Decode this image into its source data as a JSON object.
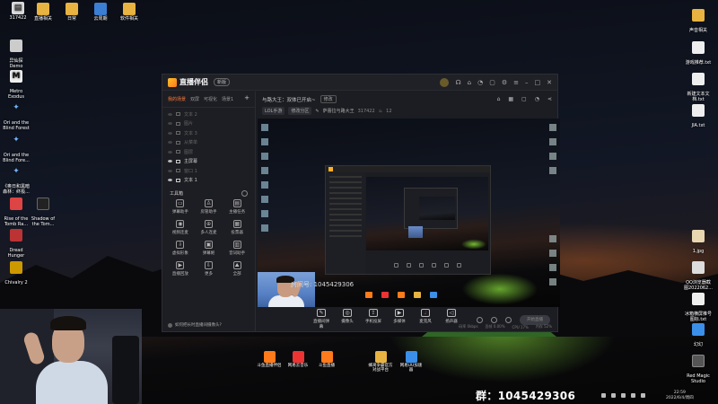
{
  "desktop": {
    "top_icons": [
      {
        "label": "直播相关",
        "color": "#e8b341"
      },
      {
        "label": "日常",
        "color": "#e8b341"
      },
      {
        "label": "云周期",
        "color": "#3b7fd4"
      },
      {
        "label": "软件相关",
        "color": "#e8b341"
      }
    ],
    "corner_label": "317422",
    "left_icons": [
      {
        "label": "异仙探\nDemo",
        "color": "#ccc"
      },
      {
        "label": "Metro\nExodus",
        "color": "#eee"
      },
      {
        "label": "Ori and the\nBlind Forest",
        "color": "#6fb3ff"
      },
      {
        "label": "Ori and the\nBlind Fore...",
        "color": "#6fb3ff"
      },
      {
        "label": "《奥日和黑暗\n森林：终极...",
        "color": "#6fb3ff"
      }
    ],
    "left_icons_row": [
      {
        "label": "Rise of the\nTomb Ra...",
        "color": "#d44"
      },
      {
        "label": "Shadow of\nthe Tom...",
        "color": "#222"
      }
    ],
    "left_icons_lower": [
      {
        "label": "Dread\nHunger",
        "color": "#b33"
      },
      {
        "label": "Chivalry 2",
        "color": "#c90"
      }
    ],
    "right_icons": [
      {
        "label": "声音相关",
        "color": "#e8b341"
      },
      {
        "label": "游戏推荐.txt",
        "color": "#eee"
      },
      {
        "label": "新建文本文\n档.txt",
        "color": "#eee"
      },
      {
        "label": "JIA.txt",
        "color": "#eee"
      },
      {
        "label": "1.jpg",
        "color": "#e8d6b0"
      },
      {
        "label": "QQ浏览器截\n图2022062...",
        "color": "#ddd"
      },
      {
        "label": "冰箱横屏推号\n图标.txt",
        "color": "#eee"
      },
      {
        "label": "幻幻",
        "color": "#3b8fe8"
      },
      {
        "label": "Red Magic\nStudio",
        "color": "#555"
      }
    ],
    "bottom_icons": [
      {
        "label": "斗鱼直播伴侣",
        "color": "#ff7a1a"
      },
      {
        "label": "网易云音乐",
        "color": "#e33"
      },
      {
        "label": "斗鱼直播",
        "color": "#ff7a1a"
      },
      {
        "label": "蜂窝争霸官方\n对战平台",
        "color": "#e8b341"
      },
      {
        "label": "网易UU加速\n器",
        "color": "#3b8fe8"
      }
    ]
  },
  "app": {
    "brand": "直播伴侣",
    "version_badge": "新版",
    "left_tabs": [
      "我的场景",
      "双屏",
      "可视化",
      "场景1"
    ],
    "scenes": [
      {
        "label": "文本 2",
        "visible": false
      },
      {
        "label": "图片",
        "visible": false
      },
      {
        "label": "文本 3",
        "visible": false
      },
      {
        "label": "从菜单",
        "visible": false
      },
      {
        "label": "图层",
        "visible": false
      },
      {
        "label": "主屏幕",
        "visible": true
      },
      {
        "label": "窗口 1",
        "visible": false
      },
      {
        "label": "文本 1",
        "visible": true
      }
    ],
    "tools_title": "工具箱",
    "tools": [
      {
        "label": "弹幕助手",
        "glyph": "▭"
      },
      {
        "label": "房管助手",
        "glyph": "♙"
      },
      {
        "label": "主播任务",
        "glyph": "▤"
      },
      {
        "label": "视频连麦",
        "glyph": "◉"
      },
      {
        "label": "多人连麦",
        "glyph": "⊕"
      },
      {
        "label": "投票器",
        "glyph": "▦"
      },
      {
        "label": "虚拟形象",
        "glyph": "⇩"
      },
      {
        "label": "弹幕姬",
        "glyph": "▣"
      },
      {
        "label": "音词助手",
        "glyph": "▥"
      },
      {
        "label": "直播回放",
        "glyph": "▶"
      },
      {
        "label": "更多",
        "glyph": "⇩"
      },
      {
        "label": "全部",
        "glyph": "⛰"
      }
    ],
    "notice": "如何把长时直播间摄像头?",
    "room_title": "与路大王：双体已开启~",
    "room_title_tag": "修改",
    "sub_tags": [
      "LOL手游",
      "修改分区"
    ],
    "sub_name": "萨蕾拉与路大王",
    "sub_num": "317422",
    "sub_fire": "12",
    "controls": [
      {
        "label": "直播间弹幕",
        "glyph": "✎"
      },
      {
        "label": "摄像头",
        "glyph": "◎"
      },
      {
        "label": "手机投屏",
        "glyph": "⇪"
      },
      {
        "label": "多媒体",
        "glyph": "▶"
      },
      {
        "label": "麦克风",
        "glyph": "♩"
      },
      {
        "label": "扬声器",
        "glyph": "◁"
      }
    ],
    "start_button": "开始直播",
    "status_items": [
      "码率 0kbps",
      "丢帧 0.00%",
      "CPU 17%",
      "内存 52%"
    ],
    "room_id": "房间号: 1045429306"
  },
  "overlay": {
    "group_text": "群：1045429306",
    "clock_time": "22:59",
    "clock_date": "2022/6/4/周四"
  }
}
